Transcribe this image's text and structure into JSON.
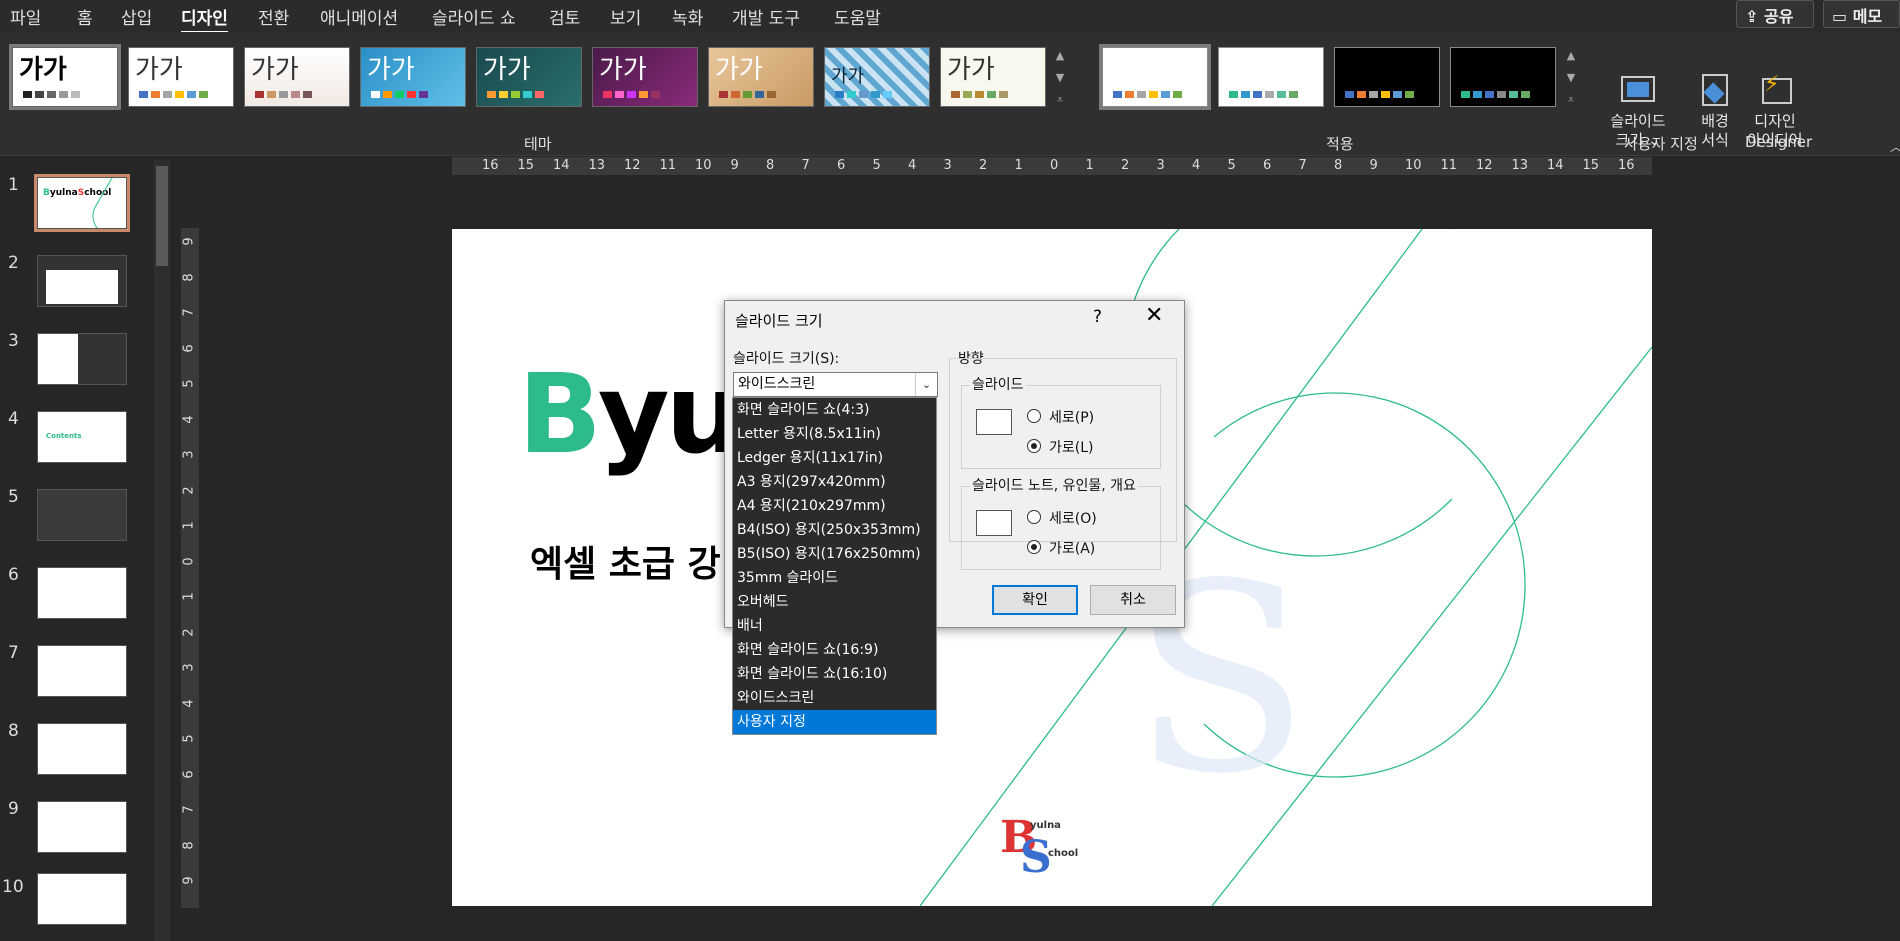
{
  "menubar": {
    "tabs": [
      "파일",
      "홈",
      "삽입",
      "디자인",
      "전환",
      "애니메이션",
      "슬라이드 쇼",
      "검토",
      "보기",
      "녹화",
      "개발 도구",
      "도움말"
    ],
    "active_tab": "디자인",
    "share_label": "공유",
    "comment_label": "메모"
  },
  "ribbon": {
    "themes_group_label": "테마",
    "variants_group_label": "적용",
    "customize_group_label": "사용자 지정",
    "designer_group_label": "Designer",
    "theme_glyph": "가가",
    "slide_size_label_1": "슬라이드",
    "slide_size_label_2": "크기",
    "format_bg_label_1": "배경",
    "format_bg_label_2": "서식",
    "design_ideas_label_1": "디자인",
    "design_ideas_label_2": "아이디어",
    "colors": {
      "accent_green": "#2dbb8c",
      "selected_blue": "#0078d7"
    }
  },
  "thumbnails": {
    "numbers": [
      "1",
      "2",
      "3",
      "4",
      "5",
      "6",
      "7",
      "8",
      "9",
      "10"
    ],
    "selected": "1"
  },
  "ruler": {
    "h_ticks": [
      "16",
      "15",
      "14",
      "13",
      "12",
      "11",
      "10",
      "9",
      "8",
      "7",
      "6",
      "5",
      "4",
      "3",
      "2",
      "1",
      "0",
      "1",
      "2",
      "3",
      "4",
      "5",
      "6",
      "7",
      "8",
      "9",
      "10",
      "11",
      "12",
      "13",
      "14",
      "15",
      "16"
    ],
    "v_ticks": [
      "9",
      "8",
      "7",
      "6",
      "5",
      "4",
      "3",
      "2",
      "1",
      "0",
      "1",
      "2",
      "3",
      "4",
      "5",
      "6",
      "7",
      "8",
      "9"
    ]
  },
  "slide": {
    "title_first_letter": "B",
    "title_rest": "yul",
    "subtitle": "엑셀 초급 강",
    "logo_top": "yulna",
    "logo_bottom": "chool"
  },
  "dialog": {
    "title": "슬라이드 크기",
    "help": "?",
    "close": "✕",
    "size_label": "슬라이드 크기(S):",
    "combo_value": "와이드스크린",
    "orientation_label": "방향",
    "slide_group_label": "슬라이드",
    "portrait_label": "세로(P)",
    "landscape_label": "가로(L)",
    "notes_group_label": "슬라이드 노트, 유인물, 개요",
    "notes_portrait_label": "세로(O)",
    "notes_landscape_label": "가로(A)",
    "ok_label": "확인",
    "cancel_label": "취소"
  },
  "dropdown": {
    "options": [
      "화면 슬라이드 쇼(4:3)",
      "Letter 용지(8.5x11in)",
      "Ledger 용지(11x17in)",
      "A3 용지(297x420mm)",
      "A4 용지(210x297mm)",
      "B4(ISO) 용지(250x353mm)",
      "B5(ISO) 용지(176x250mm)",
      "35mm 슬라이드",
      "오버헤드",
      "배너",
      "화면 슬라이드 쇼(16:9)",
      "화면 슬라이드 쇼(16:10)",
      "와이드스크린",
      "사용자 지정"
    ],
    "highlighted": "사용자 지정"
  }
}
